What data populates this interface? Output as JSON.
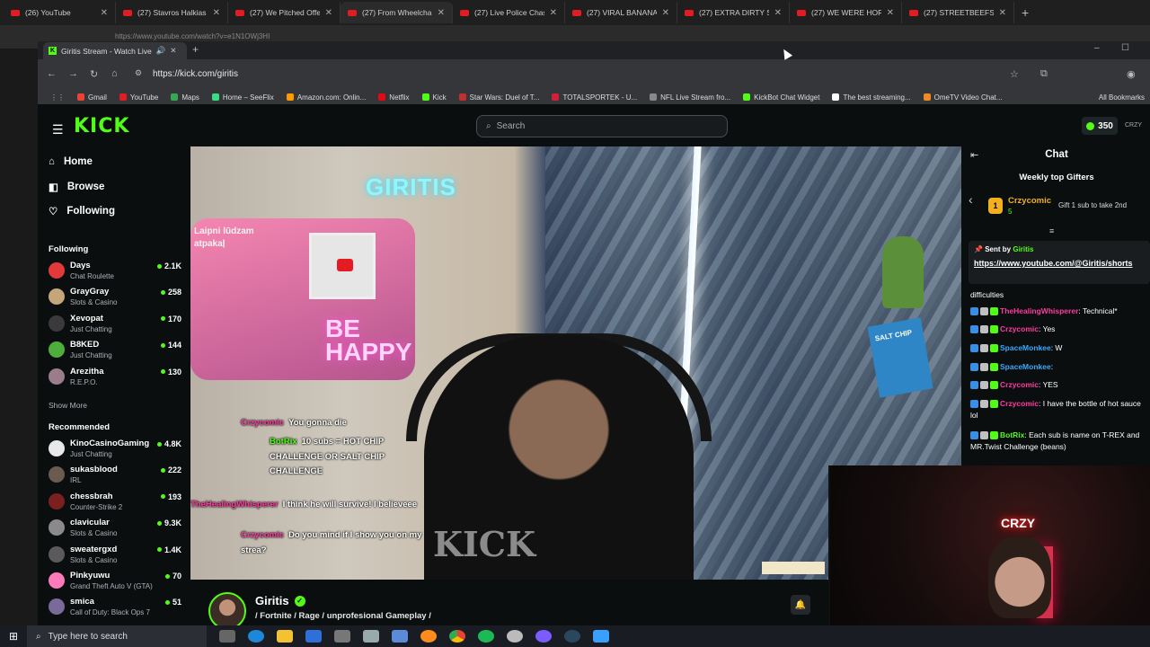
{
  "outer_browser": {
    "tabs": [
      {
        "label": "(26) YouTube"
      },
      {
        "label": "(27) Stavros Halkias R"
      },
      {
        "label": "(27) We Pitched Offen"
      },
      {
        "label": "(27) From Wheelchair"
      },
      {
        "label": "(27) Live Police Chase"
      },
      {
        "label": "(27) VIRAL BANANA V"
      },
      {
        "label": "(27) EXTRA DIRTY STU"
      },
      {
        "label": "(27) WE WERE HORRI"
      },
      {
        "label": "(27) STREETBEEFS IS R"
      }
    ],
    "active_tab_index": 3,
    "url": "https://www.youtube.com/watch?v=e1N1OWj3HI"
  },
  "inner_browser": {
    "tab_title": "Giritis Stream - Watch Live",
    "url": "https://kick.com/giritis",
    "bookmarks": [
      {
        "label": "Gmail",
        "color": "#ea4335"
      },
      {
        "label": "YouTube",
        "color": "#e31b23"
      },
      {
        "label": "Maps",
        "color": "#34a853"
      },
      {
        "label": "Home – SeeFlix",
        "color": "#3ddc84"
      },
      {
        "label": "Amazon.com: Onlin...",
        "color": "#ff9900"
      },
      {
        "label": "Netflix",
        "color": "#e50914"
      },
      {
        "label": "Kick",
        "color": "#53fc18"
      },
      {
        "label": "Star Wars: Duel of T...",
        "color": "#c03030"
      },
      {
        "label": "TOTALSPORTEK - U...",
        "color": "#d21f3c"
      },
      {
        "label": "NFL Live Stream fro...",
        "color": "#888888"
      },
      {
        "label": "KickBot Chat Widget",
        "color": "#53fc18"
      },
      {
        "label": "The best streaming...",
        "color": "#ffffff"
      },
      {
        "label": "OmeTV Video Chat...",
        "color": "#f08a24"
      }
    ],
    "all_bookmarks_label": "All Bookmarks"
  },
  "kick": {
    "logo": "KICK",
    "search_placeholder": "Search",
    "coins": "350",
    "user_badge": "CRZY",
    "nav": [
      {
        "label": "Home",
        "icon": "home-icon"
      },
      {
        "label": "Browse",
        "icon": "browse-icon"
      },
      {
        "label": "Following",
        "icon": "heart-icon"
      }
    ],
    "following_title": "Following",
    "following": [
      {
        "name": "Days",
        "category": "Chat Roulette",
        "viewers": "2.1K",
        "color": "#e23a3a"
      },
      {
        "name": "GrayGray",
        "category": "Slots & Casino",
        "viewers": "258",
        "color": "#c4a67a"
      },
      {
        "name": "Xevopat",
        "category": "Just Chatting",
        "viewers": "170",
        "color": "#3a3a3a"
      },
      {
        "name": "B8KED",
        "category": "Just Chatting",
        "viewers": "144",
        "color": "#4fae3b"
      },
      {
        "name": "Arezitha",
        "category": "R.E.P.O.",
        "viewers": "130",
        "color": "#9a7c8a"
      }
    ],
    "show_more": "Show More",
    "recommended_title": "Recommended",
    "recommended": [
      {
        "name": "KinoCasinoGaming",
        "category": "Just Chatting",
        "viewers": "4.8K",
        "color": "#e8e8e8"
      },
      {
        "name": "sukasblood",
        "category": "IRL",
        "viewers": "222",
        "color": "#6b5a50"
      },
      {
        "name": "chessbrah",
        "category": "Counter-Strike 2",
        "viewers": "193",
        "color": "#7a2020"
      },
      {
        "name": "clavicular",
        "category": "Slots & Casino",
        "viewers": "9.3K",
        "color": "#8a8a8a"
      },
      {
        "name": "sweatergxd",
        "category": "Slots & Casino",
        "viewers": "1.4K",
        "color": "#5a5a5a"
      },
      {
        "name": "Pinkyuwu",
        "category": "Grand Theft Auto V (GTA)",
        "viewers": "70",
        "color": "#ff7ab8"
      },
      {
        "name": "smica",
        "category": "Call of Duty: Black Ops 7",
        "viewers": "51",
        "color": "#7a6a9a"
      }
    ],
    "video": {
      "neon_sign": "GIRITIS",
      "tablet_text": "Laipni lūdzam atpakaļ",
      "behappy": "BE HAPPY",
      "chip_label": "SALT CHIP",
      "overlay_chat": [
        {
          "user": "Crzycomic",
          "text": "You gonna die",
          "user_color": "#ff3aa0"
        },
        {
          "user": "BotRix",
          "text": "10 subs = HOT CHIP CHALLENGE OR SALT CHIP CHALLENGE",
          "user_color": "#53fc18"
        },
        {
          "user": "TheHealingWhisperer",
          "text": "I think he will survive! I believeee",
          "user_color": "#ff3aa0"
        },
        {
          "user": "Crzycomic",
          "text": "Do you mind if I show you on my strea?",
          "user_color": "#ff3aa0"
        }
      ]
    },
    "streamer": {
      "name": "Giritis",
      "tags": "/ Fortnite / Rage / unprofesional Gameplay /"
    },
    "chat": {
      "title": "Chat",
      "weekly_top_gifters": "Weekly top Gifters",
      "top_gifter": {
        "rank": "1",
        "name": "Crzycomic",
        "count": "5"
      },
      "gift_cta": "Gift 1 sub to take 2nd",
      "pinned_sent_by": "Sent by",
      "pinned_user": "Giritis",
      "pinned_link": "https://www.youtube.com/@Giritis/shorts",
      "messages": [
        {
          "user": "",
          "text": "difficulties",
          "user_color": "#ffffff"
        },
        {
          "user": "TheHealingWhisperer",
          "text": ": Technical*",
          "user_color": "#ff3aa0"
        },
        {
          "user": "Crzycomic",
          "text": ": Yes",
          "user_color": "#ff3aa0"
        },
        {
          "user": "SpaceMonkee",
          "text": ": W",
          "user_color": "#3aa8ff"
        },
        {
          "user": "SpaceMonkee",
          "text": ":",
          "user_color": "#3aa8ff"
        },
        {
          "user": "Crzycomic",
          "text": ": YES",
          "user_color": "#ff3aa0"
        },
        {
          "user": "Crzycomic",
          "text": ": I have the bottle of hot sauce lol",
          "user_color": "#ff3aa0"
        },
        {
          "user": "BotRix",
          "text": ": Each sub is name on T-REX and MR.Twist Challenge (beans)",
          "user_color": "#53fc18"
        }
      ]
    }
  },
  "webcam": {
    "sign": "CRZY"
  },
  "taskbar": {
    "search_placeholder": "Type here to search"
  }
}
